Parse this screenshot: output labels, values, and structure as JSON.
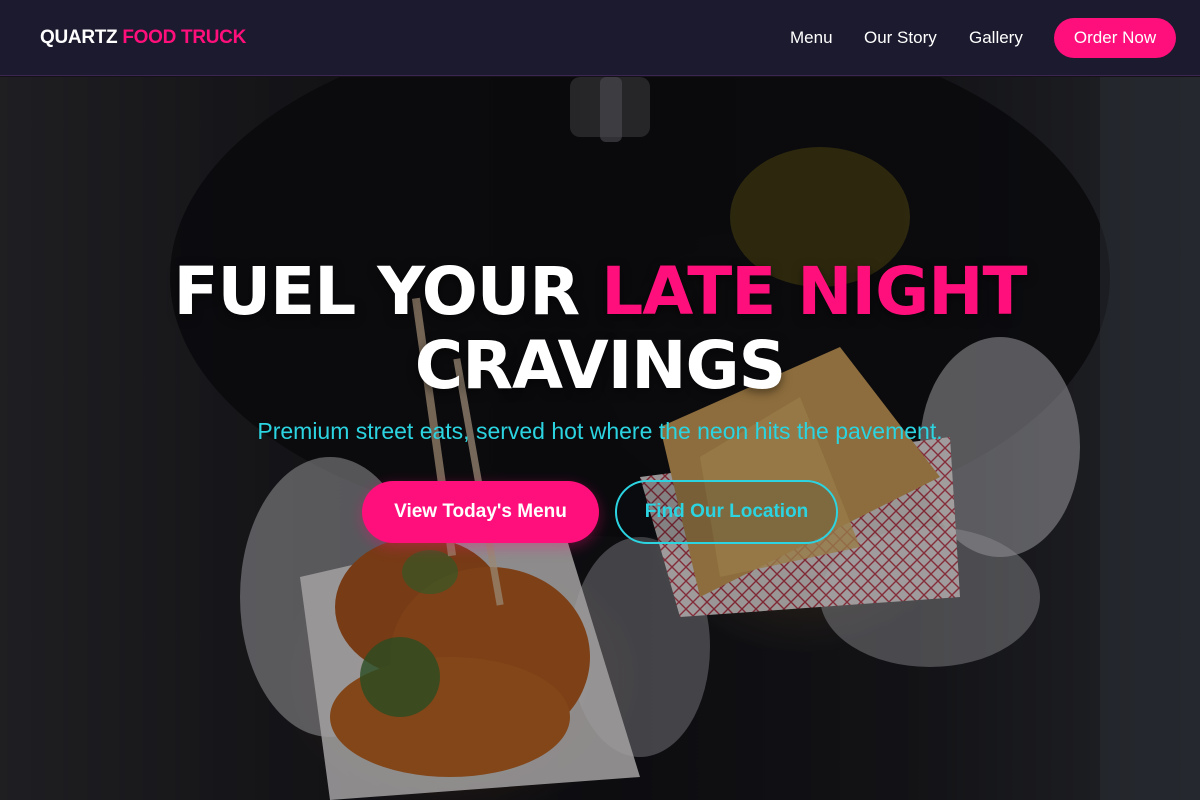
{
  "brand": {
    "name_part1": "QUARTZ",
    "name_part2": "FOOD TRUCK"
  },
  "nav": {
    "items": [
      {
        "label": "Menu"
      },
      {
        "label": "Our Story"
      },
      {
        "label": "Gallery"
      }
    ],
    "cta_label": "Order Now"
  },
  "hero": {
    "headline_part1": "FUEL YOUR",
    "headline_part2": "LATE NIGHT",
    "headline_part3": "CRAVINGS",
    "tagline": "Premium street eats, served hot where the neon hits the pavement.",
    "primary_button": "View Today's Menu",
    "secondary_button": "Find Our Location"
  },
  "colors": {
    "accent_pink": "#ff0f7b",
    "accent_cyan": "#2bd4e0",
    "header_bg": "#1b1a2e"
  }
}
